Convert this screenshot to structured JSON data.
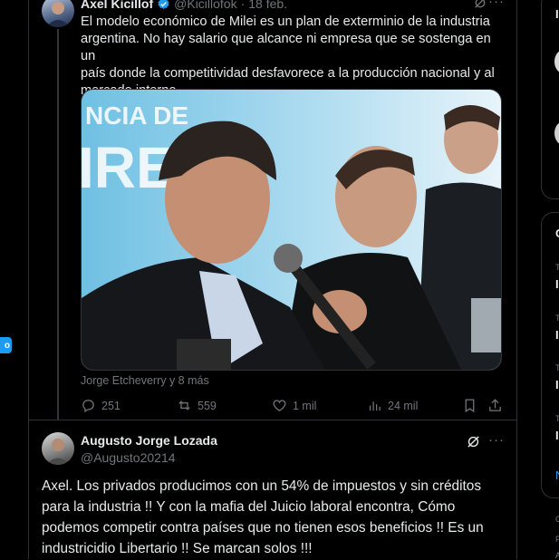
{
  "nav": {
    "partial_button_label": "o"
  },
  "tweet": {
    "author_name": "Axel Kicillof",
    "handle": "@Kicillofok",
    "separator": "·",
    "date": "18 feb.",
    "text_lines": [
      "El modelo económico de Milei es un plan de exterminio de la industria",
      "argentina. No hay salario que alcance ni empresa que se sostenga en un",
      "país donde la competitividad desfavorece a la producción nacional y al",
      "mercado interno."
    ],
    "photo_banner_text": "NCIA DE",
    "photo_banner_text2": "IRE",
    "tagged": "Jorge Etcheverry y 8 más",
    "stats": {
      "replies": "251",
      "reposts": "559",
      "likes": "1 mil",
      "views": "24 mil"
    },
    "more_label": "···"
  },
  "reply": {
    "author_name": "Augusto Jorge Lozada",
    "handle": "@Augusto20214",
    "more_label": "···",
    "text_lines": [
      "Axel. Los privados producimos con un 54% de impuestos y sin créditos",
      "para la industria !! Y con la mafia  del Juicio laboral encontra, Cómo",
      "podemos competir contra países que no tienen esos beneficios !! Es un",
      "industricidio  Libertario !! Se marcan solos !!!"
    ]
  },
  "right_column": {
    "letters": [
      "I",
      "I",
      "I",
      "I",
      "I",
      "C",
      "N"
    ],
    "tiny": [
      "T",
      "T",
      "T",
      "T",
      "C",
      "P",
      "A"
    ]
  },
  "colors": {
    "accent": "#1d9bf0",
    "background": "#000000",
    "text": "#e7e9ea",
    "muted": "#71767b",
    "border": "#2f3336"
  }
}
